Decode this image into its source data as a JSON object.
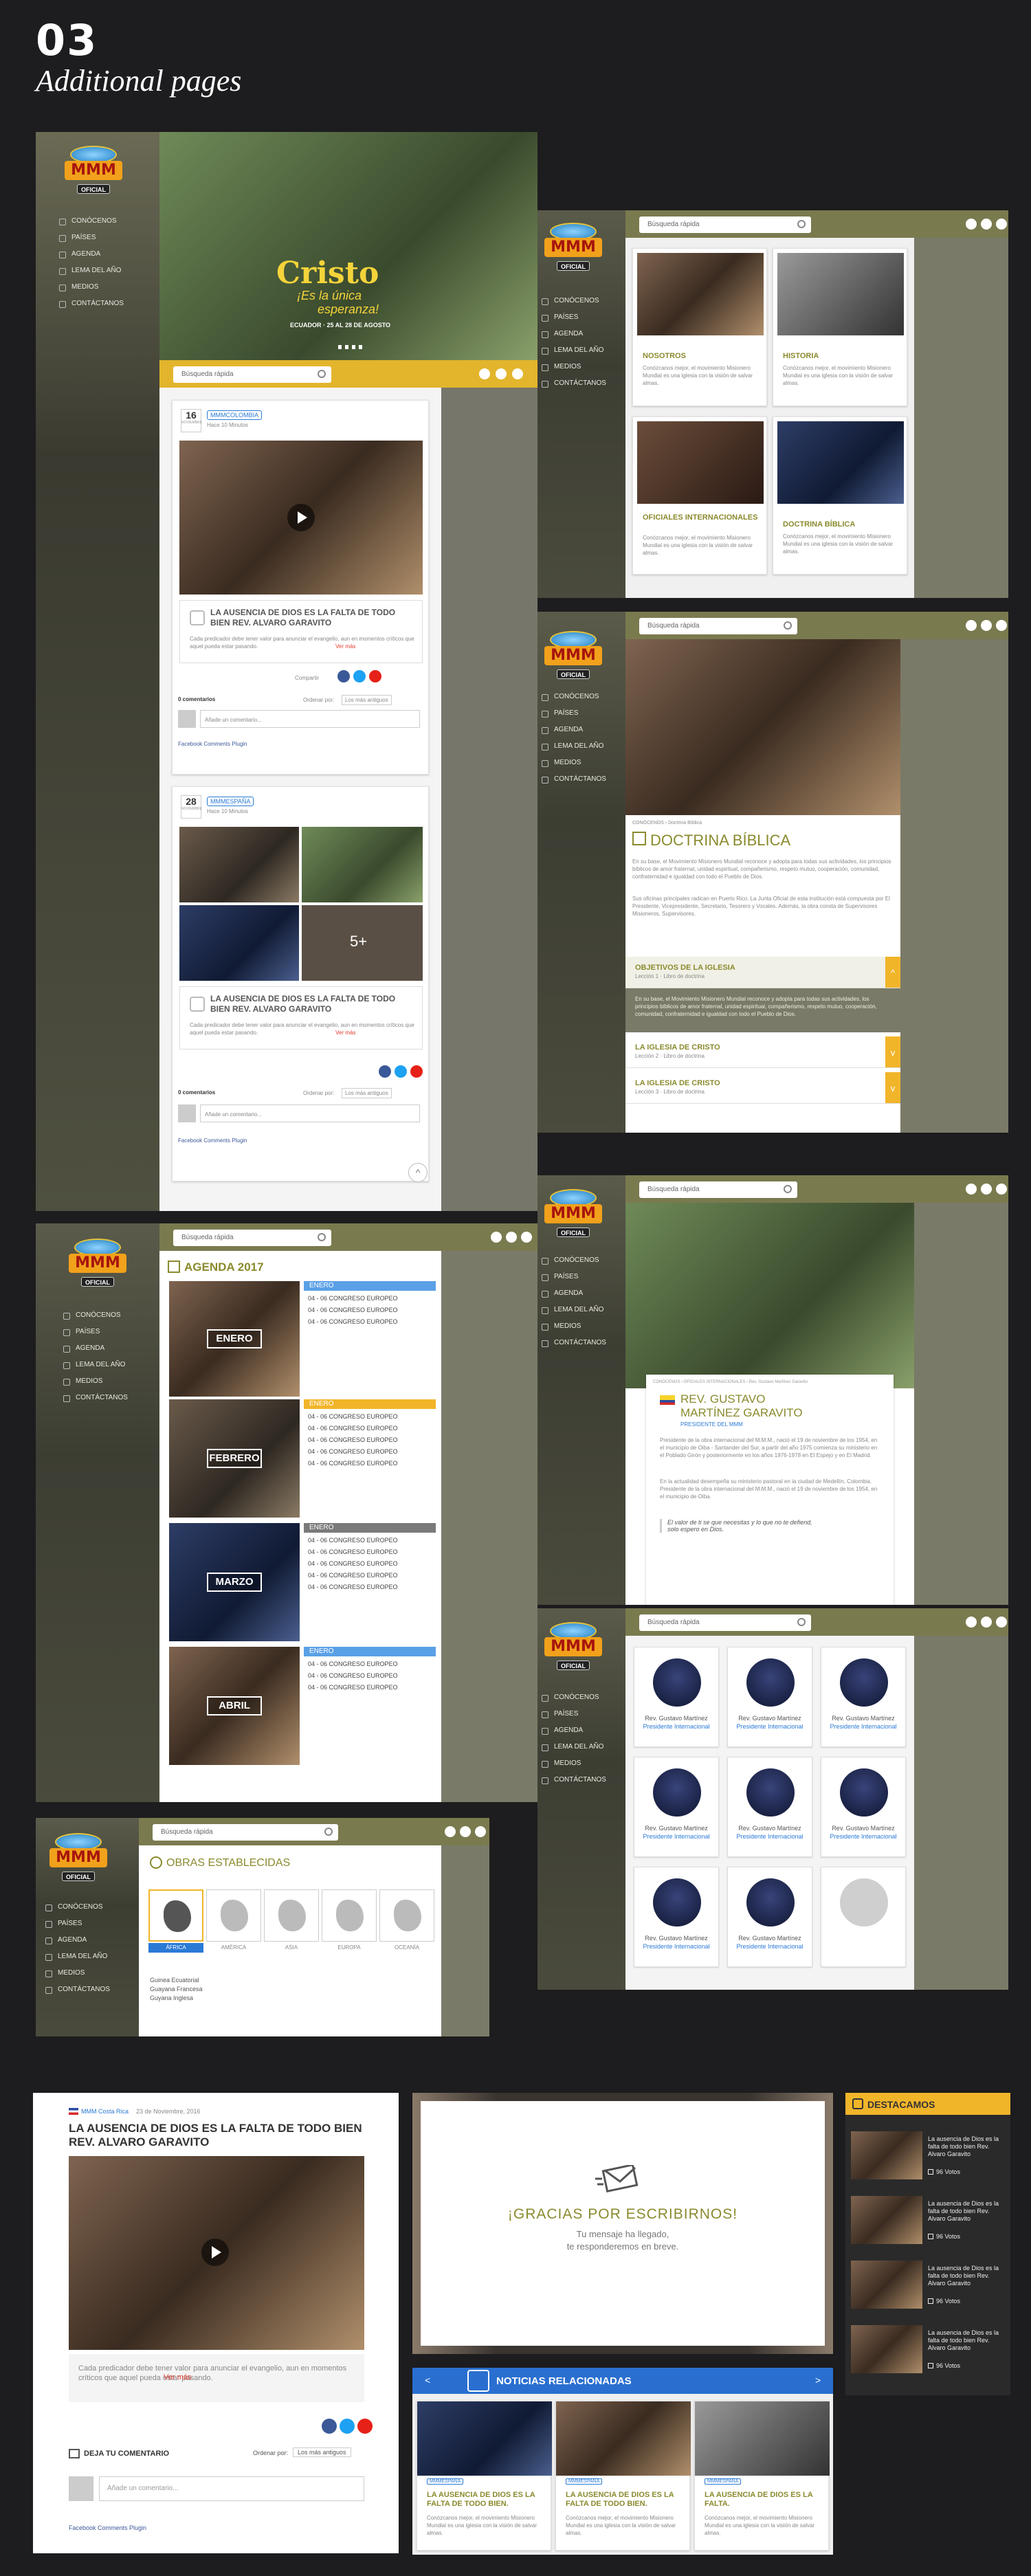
{
  "section": {
    "number": "03",
    "title": "Additional pages"
  },
  "brand": {
    "logo": "MMM",
    "badge": "OFICIAL",
    "accent": "#f1b52a",
    "olive": "#7a7a4f",
    "blue": "#2a7ad6"
  },
  "nav": {
    "short": [
      "CONÓCENOS",
      "PAÍSES",
      "AGENDA",
      "LEMA DEL AÑO",
      "MEDIOS",
      "CONTÁCTANOS"
    ]
  },
  "search": {
    "placeholder": "Búsqueda rápida"
  },
  "home": {
    "banner": {
      "line1": "Cristo",
      "line2": "¡Es la única",
      "line3": "esperanza!",
      "event": "ECUADOR · 25 AL 28 DE AGOSTO"
    },
    "post1": {
      "day": "16",
      "month": "NOVIEMBRE",
      "channel": "MMMCOLOMBIA",
      "time": "Hace 10 Minutos",
      "title": "LA AUSENCIA DE DIOS ES LA FALTA DE TODO BIEN REV. ALVARO GARAVITO",
      "excerpt": "Cada predicador debe tener valor para anunciar el evangelio, aun en momentos críticos que aquel pueda estar pasando.",
      "more": "Ver más",
      "share": "Compartir",
      "comments": "0 comentarios",
      "order_label": "Ordenar por:",
      "order_value": "Los más antiguos",
      "add_comment": "Añade un comentario...",
      "plugin": "Facebook Comments Plugin"
    },
    "post2": {
      "day": "28",
      "month": "NOVIEMBRE",
      "channel": "MMMESPAÑA",
      "time": "Hace 10 Minutos",
      "more_photos": "5+",
      "title": "LA AUSENCIA DE DIOS ES LA FALTA DE TODO BIEN REV. ALVARO GARAVITO",
      "excerpt": "Cada predicador debe tener valor para anunciar el evangelio, aun en momentos críticos que aquel pueda estar pasando.",
      "more": "Ver más",
      "comments": "0 comentarios",
      "order_label": "Ordenar por:",
      "order_value": "Los más antiguos",
      "add_comment": "Añade un comentario...",
      "plugin": "Facebook Comments Plugin"
    }
  },
  "conocenos": {
    "cards": [
      {
        "title": "NOSOTROS",
        "text": "Conózcanos mejor, el movimiento Misionero Mundial es una iglesia con la visión de salvar almas."
      },
      {
        "title": "HISTORIA",
        "text": "Conózcanos mejor, el movimiento Misionero Mundial es una iglesia con la visión de salvar almas."
      },
      {
        "title": "OFICIALES INTERNACIONALES",
        "text": "Conózcanos mejor, el movimiento Misionero Mundial es una iglesia con la visión de salvar almas."
      },
      {
        "title": "DOCTRINA BÍBLICA",
        "text": "Conózcanos mejor, el movimiento Misionero Mundial es una iglesia con la visión de salvar almas."
      }
    ]
  },
  "doctrina": {
    "crumb": "CONÓCENOS › Doctrina Bíblica",
    "title": "DOCTRINA BÍBLICA",
    "p1": "En su base, el Movimiento Misionero Mundial reconoce y adopta para todas sus actividades, los principios bíblicos de amor fraternal, unidad espiritual, compañerismo, respeto mutuo, cooperación, comunidad, confraternidad e igualdad con todo el Pueblo de Dios.",
    "p2": "Sus oficinas principales radican en Puerto Rico. La Junta Oficial de esta institución está compuesta por El Presidente, Vicepresidente, Secretario, Tesorero y Vocales. Además, la obra consta de Supervisores Misioneros, Supervisores.",
    "items": [
      {
        "title": "OBJETIVOS DE LA IGLESIA",
        "sub": "Lección 1 · Libro de doctrina"
      },
      {
        "title": "LA IGLESIA DE CRISTO",
        "sub": "Lección 2 · Libro de doctrina"
      },
      {
        "title": "LA IGLESIA DE CRISTO",
        "sub": "Lección 3 · Libro de doctrina"
      }
    ],
    "open_text": "En su base, el Movimiento Misionero Mundial reconoce y adopta para todas sus actividades, los principios bíblicos de amor fraternal, unidad espiritual, compañerismo, respeto mutuo, cooperación, comunidad, confraternidad e igualdad con todo el Pueblo de Dios."
  },
  "agenda": {
    "title": "AGENDA 2017",
    "months": [
      {
        "label": "ENERO",
        "head": "ENERO",
        "color": "#5aa0e6",
        "rows": [
          "04 - 06 CONGRESO EUROPEO",
          "04 - 06 CONGRESO EUROPEO",
          "04 - 06 CONGRESO EUROPEO"
        ]
      },
      {
        "label": "FEBRERO",
        "head": "ENERO",
        "color": "#f1b52a",
        "rows": [
          "04 - 06 CONGRESO EUROPEO",
          "04 - 06 CONGRESO EUROPEO",
          "04 - 06 CONGRESO EUROPEO",
          "04 - 06 CONGRESO EUROPEO",
          "04 - 06 CONGRESO EUROPEO"
        ]
      },
      {
        "label": "MARZO",
        "head": "ENERO",
        "color": "#7a7a7a",
        "rows": [
          "04 - 06 CONGRESO EUROPEO",
          "04 - 06 CONGRESO EUROPEO",
          "04 - 06 CONGRESO EUROPEO",
          "04 - 06 CONGRESO EUROPEO",
          "04 - 06 CONGRESO EUROPEO"
        ]
      },
      {
        "label": "ABRIL",
        "head": "ENERO",
        "color": "#5aa0e6",
        "rows": [
          "04 - 06 CONGRESO EUROPEO",
          "04 - 06 CONGRESO EUROPEO",
          "04 - 06 CONGRESO EUROPEO"
        ]
      }
    ]
  },
  "oficial": {
    "crumb": "CONÓCENOS › OFICIALES INTERNACIONALES › Rev. Gustavo Martínez Garavito",
    "name1": "REV. GUSTAVO",
    "name2": "MARTÍNEZ GARAVITO",
    "role": "PRESIDENTE DEL MMM",
    "p1": "Presidente de la obra internacional del M.M.M., nació el 19 de noviembre de los 1954, en el municipio de Oiba - Santander del Sur, a partir del año 1975 comienza su ministerio en el Poblado Girón y posteriormente en los años 1976-1978 en El Espejo y en El Madrid.",
    "p2": "En la actualidad desempeña su ministerio pastoral en la ciudad de Medellín, Colombia. Presidente de la obra internacional del M.M.M., nació el 19 de noviembre de los 1954, en el municipio de Oiba.",
    "quote": "El valor de ti se que necesitas y lo que no te defiend, solo espero en Dios."
  },
  "oficiales": {
    "people": [
      {
        "name": "Rev. Gustavo Martínez",
        "role": "Presidente Internacional"
      },
      {
        "name": "Rev. Gustavo Martínez",
        "role": "Presidente Internacional"
      },
      {
        "name": "Rev. Gustavo Martínez",
        "role": "Presidente Internacional"
      },
      {
        "name": "Rev. Gustavo Martínez",
        "role": "Presidente Internacional"
      },
      {
        "name": "Rev. Gustavo Martínez",
        "role": "Presidente Internacional"
      },
      {
        "name": "Rev. Gustavo Martínez",
        "role": "Presidente Internacional"
      },
      {
        "name": "Rev. Gustavo Martínez",
        "role": "Presidente Internacional"
      },
      {
        "name": "Rev. Gustavo Martínez",
        "role": "Presidente Internacional"
      }
    ]
  },
  "obras": {
    "title": "OBRAS ESTABLECIDAS",
    "continents": [
      "ÁFRICA",
      "AMÉRICA",
      "ASIA",
      "EUROPA",
      "OCEANÍA"
    ],
    "countries": [
      "Guinea Ecuatorial",
      "Guayana Francesa",
      "Guyana Inglesa"
    ]
  },
  "detail": {
    "channel": "MMM Costa Rica",
    "date": "23 de Noviembre, 2016",
    "title": "LA AUSENCIA DE DIOS ES LA FALTA DE TODO BIEN REV. ALVARO GARAVITO",
    "excerpt": "Cada predicador debe tener valor para anunciar el evangelio, aun en momentos críticos que aquel pueda estar pasando.",
    "more": "Ver más",
    "comment_head": "DEJA TU COMENTARIO",
    "order_label": "Ordenar por:",
    "order_value": "Los más antiguos",
    "add_comment": "Añade un comentario...",
    "plugin": "Facebook Comments Plugin"
  },
  "thanks": {
    "title": "¡GRACIAS POR ESCRIBIRNOS!",
    "line1": "Tu mensaje ha llegado,",
    "line2": "te responderemos en breve."
  },
  "related": {
    "title": "NOTICIAS RELACIONADAS",
    "items": [
      {
        "tag": "MMMESPAÑA",
        "title": "LA AUSENCIA DE DIOS ES LA FALTA DE TODO BIEN.",
        "text": "Conózcanos mejor, el movimiento Misionero Mundial es una iglesia con la visión de salvar almas."
      },
      {
        "tag": "MMMESPAÑA",
        "title": "LA AUSENCIA DE DIOS ES LA FALTA DE TODO BIEN.",
        "text": "Conózcanos mejor, el movimiento Misionero Mundial es una iglesia con la visión de salvar almas."
      },
      {
        "tag": "MMMESPAÑA",
        "title": "LA AUSENCIA DE DIOS ES LA FALTA.",
        "text": "Conózcanos mejor, el movimiento Misionero Mundial es una iglesia con la visión de salvar almas."
      }
    ]
  },
  "destacamos": {
    "title": "DESTACAMOS",
    "items": [
      {
        "title": "La ausencia de Dios es la falta de todo bien Rev. Alvaro Garavito",
        "votes": "96 Votos"
      },
      {
        "title": "La ausencia de Dios es la falta de todo bien Rev. Alvaro Garavito",
        "votes": "96 Votos"
      },
      {
        "title": "La ausencia de Dios es la falta de todo bien Rev. Alvaro Garavito",
        "votes": "96 Votos"
      },
      {
        "title": "La ausencia de Dios es la falta de todo bien Rev. Alvaro Garavito",
        "votes": "96 Votos"
      }
    ]
  }
}
